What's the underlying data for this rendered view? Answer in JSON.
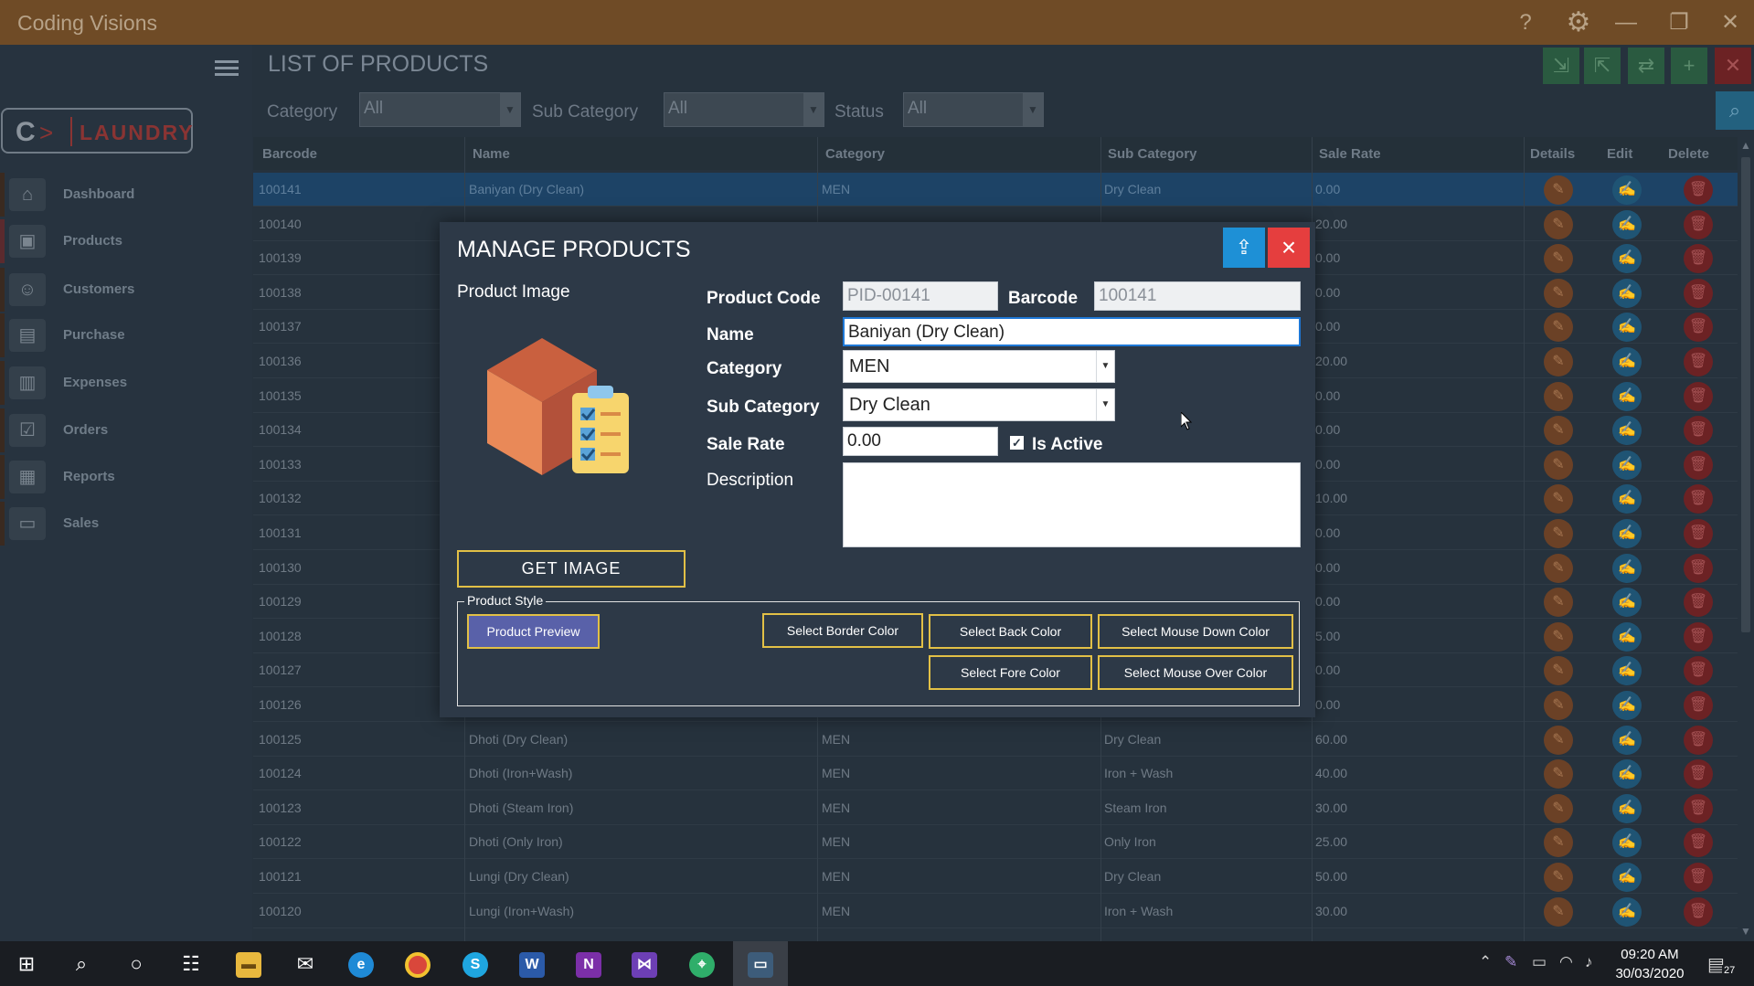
{
  "window": {
    "title": "Coding Visions"
  },
  "logo": {
    "letter": "C",
    "text": "LAUNDRY"
  },
  "sidebar": {
    "items": [
      {
        "label": "Dashboard",
        "icon": "home-icon"
      },
      {
        "label": "Products",
        "icon": "box-icon"
      },
      {
        "label": "Customers",
        "icon": "customers-icon"
      },
      {
        "label": "Purchase",
        "icon": "purchase-icon"
      },
      {
        "label": "Expenses",
        "icon": "expenses-icon"
      },
      {
        "label": "Orders",
        "icon": "orders-icon"
      },
      {
        "label": "Reports",
        "icon": "reports-icon"
      },
      {
        "label": "Sales",
        "icon": "sales-icon"
      }
    ]
  },
  "list": {
    "title": "LIST OF PRODUCTS",
    "filters": {
      "category_label": "Category",
      "category_value": "All",
      "subcategory_label": "Sub Category",
      "subcategory_value": "All",
      "status_label": "Status",
      "status_value": "All"
    },
    "columns": [
      "Barcode",
      "Name",
      "Category",
      "Sub Category",
      "Sale Rate",
      "Details",
      "Edit",
      "Delete"
    ],
    "rows": [
      {
        "barcode": "100141",
        "name": "Baniyan (Dry Clean)",
        "category": "MEN",
        "sub": "Dry Clean",
        "rate": "0.00",
        "selected": true
      },
      {
        "barcode": "100140",
        "name": "",
        "category": "",
        "sub": "",
        "rate": "20.00"
      },
      {
        "barcode": "100139",
        "name": "",
        "category": "",
        "sub": "",
        "rate": "0.00"
      },
      {
        "barcode": "100138",
        "name": "",
        "category": "",
        "sub": "",
        "rate": "0.00"
      },
      {
        "barcode": "100137",
        "name": "",
        "category": "",
        "sub": "",
        "rate": "0.00"
      },
      {
        "barcode": "100136",
        "name": "",
        "category": "",
        "sub": "",
        "rate": "20.00"
      },
      {
        "barcode": "100135",
        "name": "",
        "category": "",
        "sub": "",
        "rate": "0.00"
      },
      {
        "barcode": "100134",
        "name": "",
        "category": "",
        "sub": "",
        "rate": "0.00"
      },
      {
        "barcode": "100133",
        "name": "",
        "category": "",
        "sub": "",
        "rate": "0.00"
      },
      {
        "barcode": "100132",
        "name": "",
        "category": "",
        "sub": "",
        "rate": "10.00"
      },
      {
        "barcode": "100131",
        "name": "",
        "category": "",
        "sub": "",
        "rate": "0.00"
      },
      {
        "barcode": "100130",
        "name": "",
        "category": "",
        "sub": "",
        "rate": "0.00"
      },
      {
        "barcode": "100129",
        "name": "",
        "category": "",
        "sub": "",
        "rate": "0.00"
      },
      {
        "barcode": "100128",
        "name": "",
        "category": "",
        "sub": "",
        "rate": "5.00"
      },
      {
        "barcode": "100127",
        "name": "",
        "category": "",
        "sub": "",
        "rate": "0.00"
      },
      {
        "barcode": "100126",
        "name": "",
        "category": "",
        "sub": "",
        "rate": "0.00"
      },
      {
        "barcode": "100125",
        "name": "Dhoti (Dry Clean)",
        "category": "MEN",
        "sub": "Dry Clean",
        "rate": "60.00"
      },
      {
        "barcode": "100124",
        "name": "Dhoti (Iron+Wash)",
        "category": "MEN",
        "sub": "Iron + Wash",
        "rate": "40.00"
      },
      {
        "barcode": "100123",
        "name": "Dhoti (Steam Iron)",
        "category": "MEN",
        "sub": "Steam Iron",
        "rate": "30.00"
      },
      {
        "barcode": "100122",
        "name": "Dhoti (Only Iron)",
        "category": "MEN",
        "sub": "Only Iron",
        "rate": "25.00"
      },
      {
        "barcode": "100121",
        "name": "Lungi (Dry Clean)",
        "category": "MEN",
        "sub": "Dry Clean",
        "rate": "50.00"
      },
      {
        "barcode": "100120",
        "name": "Lungi (Iron+Wash)",
        "category": "MEN",
        "sub": "Iron + Wash",
        "rate": "30.00"
      }
    ]
  },
  "modal": {
    "title": "MANAGE PRODUCTS",
    "image_label": "Product Image",
    "get_image_label": "GET IMAGE",
    "product_code_label": "Product Code",
    "product_code_value": "PID-00141",
    "barcode_label": "Barcode",
    "barcode_value": "100141",
    "name_label": "Name",
    "name_value": "Baniyan (Dry Clean)",
    "category_label": "Category",
    "category_value": "MEN",
    "subcategory_label": "Sub Category",
    "subcategory_value": "Dry Clean",
    "sale_rate_label": "Sale Rate",
    "sale_rate_value": "0.00",
    "is_active_label": "Is Active",
    "is_active_checked": true,
    "description_label": "Description",
    "description_value": "",
    "style": {
      "legend": "Product Style",
      "preview_label": "Product Preview",
      "border_color_label": "Select Border Color",
      "back_color_label": "Select Back Color",
      "mouse_down_label": "Select Mouse Down Color",
      "fore_color_label": "Select Fore Color",
      "mouse_over_label": "Select Mouse Over Color"
    }
  },
  "taskbar": {
    "time": "09:20 AM",
    "date": "30/03/2020",
    "notifications": "27"
  },
  "colors": {
    "titlebar": "#6f4b26",
    "accent_yellow": "#e2c046",
    "close_red": "#e53e3e",
    "share_blue": "#1e90d6",
    "preview_purple": "#5961a9",
    "selected_row": "#1d4366"
  }
}
